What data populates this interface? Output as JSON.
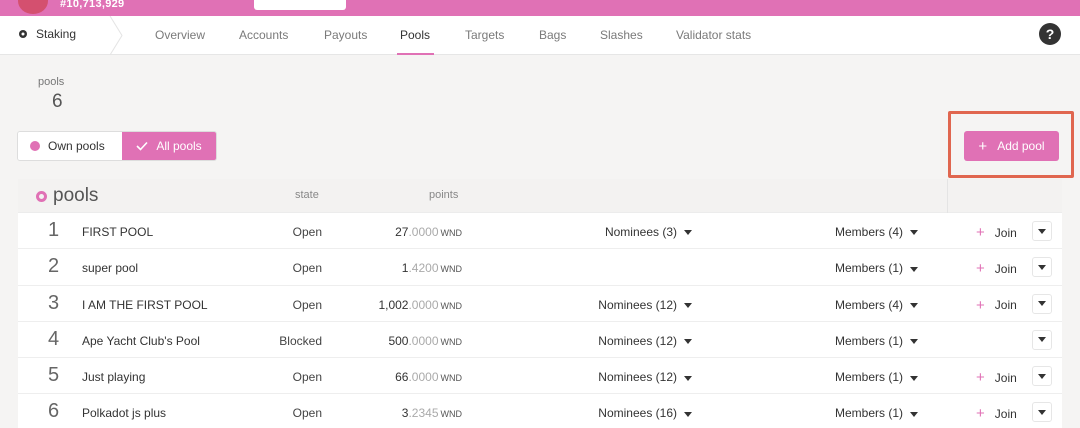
{
  "header": {
    "block_number": "#10,713,929"
  },
  "menu": {
    "section_label": "Staking",
    "tabs": [
      {
        "label": "Overview",
        "active": false
      },
      {
        "label": "Accounts",
        "active": false
      },
      {
        "label": "Payouts",
        "active": false
      },
      {
        "label": "Pools",
        "active": true
      },
      {
        "label": "Targets",
        "active": false
      },
      {
        "label": "Bags",
        "active": false
      },
      {
        "label": "Slashes",
        "active": false
      },
      {
        "label": "Validator stats",
        "active": false
      }
    ],
    "help_label": "?"
  },
  "summary": {
    "label": "pools",
    "value": "6"
  },
  "filter": {
    "own_label": "Own pools",
    "all_label": "All pools",
    "selected": "All pools"
  },
  "add_pool": {
    "label": "Add pool",
    "icon": "plus-icon"
  },
  "table": {
    "title": "pools",
    "col_state": "state",
    "col_points": "points",
    "rows": [
      {
        "num": "1",
        "name": "FIRST POOL",
        "state": "Open",
        "points_int": "27",
        "points_dec": ".0000",
        "unit": "WND",
        "nominees": "Nominees (3)",
        "members": "Members (4)",
        "join": "Join"
      },
      {
        "num": "2",
        "name": "super pool",
        "state": "Open",
        "points_int": "1",
        "points_dec": ".4200",
        "unit": "WND",
        "nominees": "",
        "members": "Members (1)",
        "join": "Join"
      },
      {
        "num": "3",
        "name": "I AM THE FIRST POOL",
        "state": "Open",
        "points_int": "1,002",
        "points_dec": ".0000",
        "unit": "WND",
        "nominees": "Nominees (12)",
        "members": "Members (4)",
        "join": "Join"
      },
      {
        "num": "4",
        "name": "Ape Yacht Club's Pool",
        "state": "Blocked",
        "points_int": "500",
        "points_dec": ".0000",
        "unit": "WND",
        "nominees": "Nominees (12)",
        "members": "Members (1)",
        "join": ""
      },
      {
        "num": "5",
        "name": "Just playing",
        "state": "Open",
        "points_int": "66",
        "points_dec": ".0000",
        "unit": "WND",
        "nominees": "Nominees (12)",
        "members": "Members (1)",
        "join": "Join"
      },
      {
        "num": "6",
        "name": "Polkadot js plus",
        "state": "Open",
        "points_int": "3",
        "points_dec": ".2345",
        "unit": "WND",
        "nominees": "Nominees (16)",
        "members": "Members (1)",
        "join": "Join"
      }
    ]
  },
  "colors": {
    "accent": "#e071b5",
    "highlight_border": "#e0664f"
  }
}
